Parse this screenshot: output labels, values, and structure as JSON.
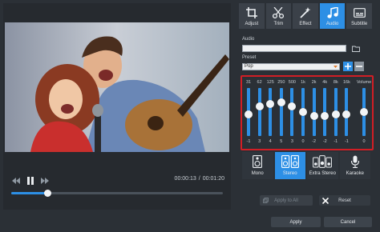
{
  "player": {
    "time_current": "00:00:13",
    "time_total": "00:01:20",
    "time_separator": "/",
    "progress": 0.17
  },
  "tabs": [
    {
      "label": "Adjust",
      "icon": "crop-icon",
      "active": false
    },
    {
      "label": "Trim",
      "icon": "scissors-icon",
      "active": false
    },
    {
      "label": "Effect",
      "icon": "magic-wand-icon",
      "active": false
    },
    {
      "label": "Audio",
      "icon": "music-note-icon",
      "active": true
    },
    {
      "label": "Subtitle",
      "icon": "subtitle-icon",
      "active": false
    }
  ],
  "audio": {
    "label": "Audio",
    "value": "",
    "preset_label": "Preset",
    "preset_value": "Pop"
  },
  "equalizer": {
    "bands": [
      {
        "freq": "31",
        "value": "-1"
      },
      {
        "freq": "62",
        "value": "3"
      },
      {
        "freq": "125",
        "value": "4"
      },
      {
        "freq": "250",
        "value": "5"
      },
      {
        "freq": "500",
        "value": "3"
      },
      {
        "freq": "1k",
        "value": "0"
      },
      {
        "freq": "2k",
        "value": "-2"
      },
      {
        "freq": "4k",
        "value": "-2"
      },
      {
        "freq": "8k",
        "value": "-1"
      },
      {
        "freq": "16k",
        "value": "-1"
      }
    ],
    "volume_label": "Volume",
    "volume_value": "0"
  },
  "modes": [
    {
      "label": "Mono",
      "icon": "speaker-icon",
      "active": false
    },
    {
      "label": "Stereo",
      "icon": "stereo-speakers-icon",
      "active": true
    },
    {
      "label": "Extra Stereo",
      "icon": "extra-stereo-icon",
      "active": false
    },
    {
      "label": "Karaoke",
      "icon": "microphone-icon",
      "active": false
    }
  ],
  "buttons": {
    "apply_all": "Apply to All",
    "reset": "Reset",
    "apply": "Apply",
    "cancel": "Cancel"
  },
  "colors": {
    "accent": "#2d8fe5",
    "highlight_border": "#d21e25",
    "background": "#2b3036"
  }
}
